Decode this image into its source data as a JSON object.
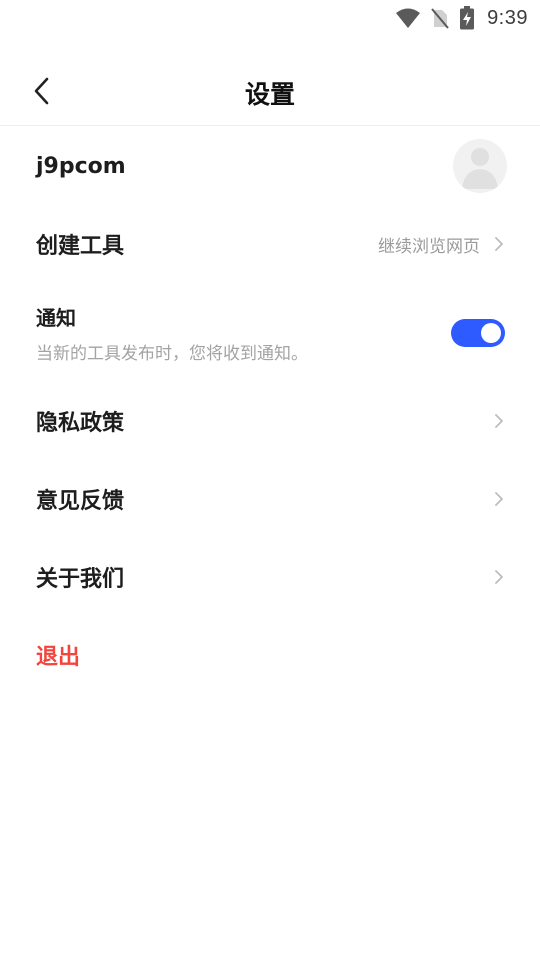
{
  "status_bar": {
    "time": "9:39",
    "icons": [
      "wifi-icon",
      "no-sim-icon",
      "battery-charging-icon"
    ]
  },
  "header": {
    "title": "设置",
    "back_icon": "chevron-left-icon"
  },
  "profile": {
    "username": "j9pcom",
    "avatar_icon": "default-avatar-icon"
  },
  "rows": {
    "create_tool": {
      "label": "创建工具",
      "hint": "继续浏览网页"
    },
    "notification": {
      "label": "通知",
      "description": "当新的工具发布时，您将收到通知。",
      "enabled": true
    },
    "privacy": {
      "label": "隐私政策"
    },
    "feedback": {
      "label": "意见反馈"
    },
    "about": {
      "label": "关于我们"
    },
    "logout": {
      "label": "退出"
    }
  },
  "colors": {
    "accent": "#2e5bff",
    "danger": "#f2453d",
    "hint_text": "#9a9a9a",
    "divider": "#eeeeee"
  }
}
